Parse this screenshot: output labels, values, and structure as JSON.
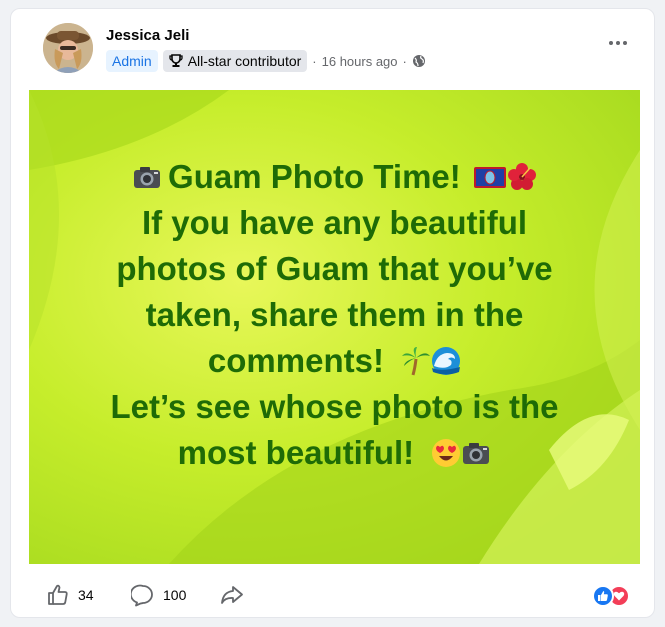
{
  "post": {
    "author": "Jessica Jeli",
    "role_badge": "Admin",
    "contributor_badge": "All-star contributor",
    "separator": "·",
    "timestamp": "16 hours ago",
    "privacy_icon": "globe-icon"
  },
  "banner": {
    "lines": [
      "Guam Photo Time!",
      "If you have any beautiful",
      "photos of Guam that you’ve",
      "taken, share them in the",
      "comments!",
      "Let’s see whose photo is the",
      "most beautiful!"
    ],
    "text_color": "#1e6b06",
    "background_color": "#c6ed2b"
  },
  "engagement": {
    "likes": "34",
    "comments": "100",
    "reaction_icons": [
      "like-reaction-icon",
      "love-reaction-icon"
    ]
  },
  "colors": {
    "admin_badge_bg": "#e7f3ff",
    "admin_badge_text": "#1b74e4",
    "like_blue": "#1877f2",
    "love_red": "#f33e58"
  }
}
